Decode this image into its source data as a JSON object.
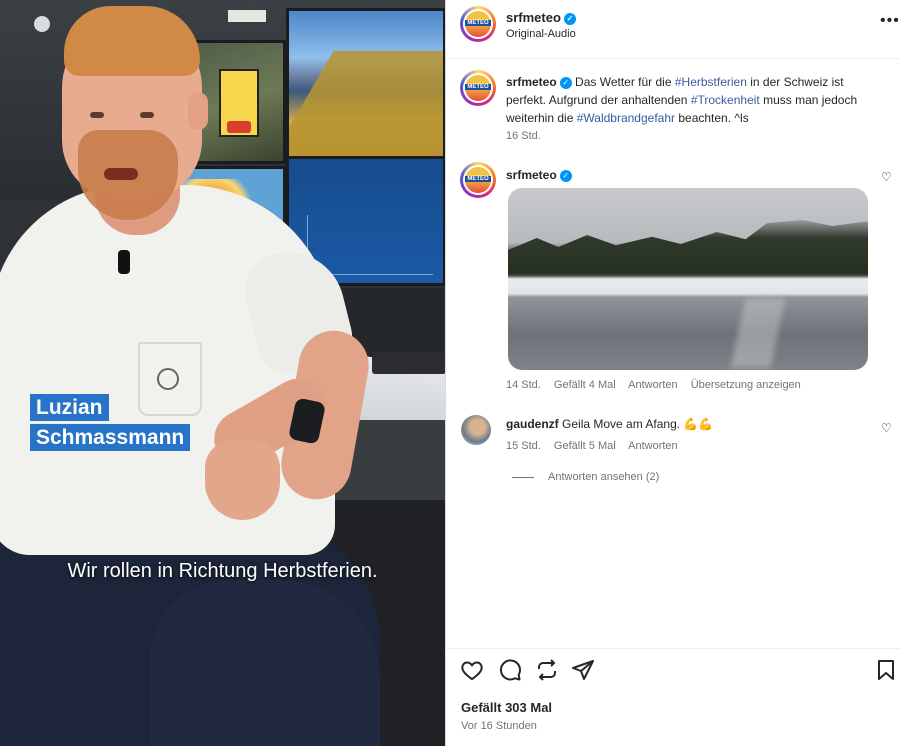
{
  "video": {
    "name_line1": "Luzian",
    "name_line2": "Schmassmann",
    "subtitle": "Wir rollen in Richtung Herbstferien."
  },
  "header": {
    "username": "srfmeteo",
    "audio": "Original-Audio",
    "avatar_text": "METEO",
    "more": "•••"
  },
  "caption_post": {
    "username": "srfmeteo",
    "text_a": "Das Wetter für die ",
    "tag1": "#Herbstferien",
    "text_b": " in der Schweiz ist perfekt. Aufgrund der anhaltenden ",
    "tag2": "#Trockenheit",
    "text_c": " muss man jedoch weiterhin die ",
    "tag3": "#Waldbrandgefahr",
    "text_d": " beachten. ^ls",
    "time": "16 Std."
  },
  "comment1": {
    "username": "srfmeteo",
    "time": "14 Std.",
    "likes": "Gefällt 4 Mal",
    "reply": "Antworten",
    "translate": "Übersetzung anzeigen"
  },
  "comment2": {
    "username": "gaudenzf",
    "text": "Geila Move am Afang. 💪💪",
    "time": "15 Std.",
    "likes": "Gefällt 5 Mal",
    "reply": "Antworten"
  },
  "view_replies": "Antworten ansehen (2)",
  "footer": {
    "likes": "Gefällt 303 Mal",
    "ago": "Vor 16 Stunden"
  },
  "colors": {
    "name_tag_bg": "#2673c8",
    "verified": "#0095f6",
    "hashtag": "#3a5ba0"
  }
}
